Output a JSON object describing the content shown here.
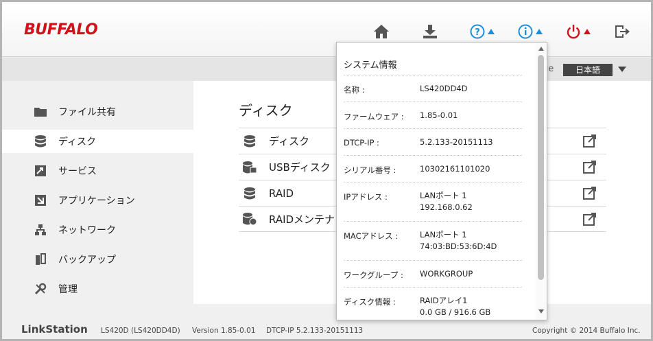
{
  "header": {
    "logo": "BUFFALO",
    "icons": [
      "home-icon",
      "download-icon",
      "help-icon",
      "info-icon",
      "power-icon",
      "logout-icon"
    ],
    "brand_red": "#d0121b",
    "accent_blue": "#1a8fd8"
  },
  "language": {
    "label": "ge",
    "value": "日本語"
  },
  "sidebar": {
    "items": [
      {
        "label": "ファイル共有",
        "icon": "folder-icon"
      },
      {
        "label": "ディスク",
        "icon": "disk-icon"
      },
      {
        "label": "サービス",
        "icon": "service-icon"
      },
      {
        "label": "アプリケーション",
        "icon": "application-icon"
      },
      {
        "label": "ネットワーク",
        "icon": "network-icon"
      },
      {
        "label": "バックアップ",
        "icon": "backup-icon"
      },
      {
        "label": "管理",
        "icon": "tools-icon"
      }
    ],
    "active_index": 1
  },
  "main": {
    "title": "ディスク",
    "rows": [
      {
        "label": "ディスク",
        "icon": "disk-icon"
      },
      {
        "label": "USBディスク",
        "icon": "usb-disk-icon"
      },
      {
        "label": "RAID",
        "icon": "raid-icon"
      },
      {
        "label": "RAIDメンテナ",
        "icon": "raid-maintenance-icon"
      }
    ]
  },
  "popup": {
    "title": "システム情報",
    "rows": [
      {
        "key": "名称 :",
        "lines": [
          "LS420DD4D"
        ]
      },
      {
        "key": "ファームウェア :",
        "lines": [
          "1.85-0.01"
        ]
      },
      {
        "key": "DTCP-IP :",
        "lines": [
          "5.2.133-20151113"
        ]
      },
      {
        "key": "シリアル番号 :",
        "lines": [
          "10302161101020"
        ]
      },
      {
        "key": "IPアドレス :",
        "lines": [
          "LANポート 1",
          "192.168.0.62"
        ]
      },
      {
        "key": "MACアドレス :",
        "lines": [
          "LANポート 1",
          "74:03:BD:53:6D:4D"
        ]
      },
      {
        "key": "ワークグループ :",
        "lines": [
          "WORKGROUP"
        ]
      },
      {
        "key": "ディスク情報 :",
        "lines": [
          "RAIDアレイ1",
          "0.0 GB / 916.6 GB"
        ]
      }
    ]
  },
  "footer": {
    "brand": "LinkStation",
    "model": "LS420D (LS420DD4D)",
    "version": "Version 1.85-0.01",
    "dtcp": "DTCP-IP 5.2.133-20151113",
    "copyright": "Copyright © 2014 Buffalo Inc."
  }
}
